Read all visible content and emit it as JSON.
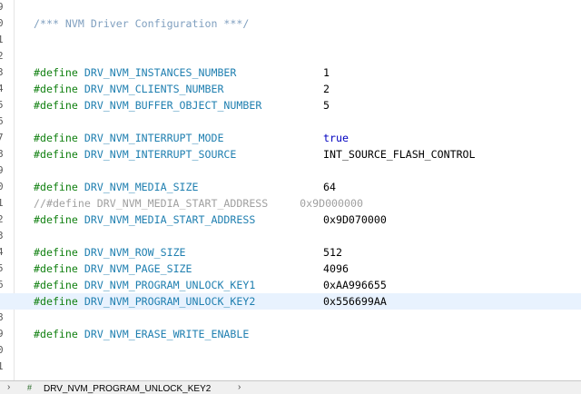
{
  "editor": {
    "line_numbers": [
      "9",
      "0",
      "1",
      "2",
      "3",
      "4",
      "5",
      "6",
      "7",
      "8",
      "9",
      "0",
      "1",
      "2",
      "3",
      "4",
      "5",
      "6",
      "7",
      "8",
      "9",
      "0",
      "1"
    ],
    "lines": [
      {
        "type": "blank"
      },
      {
        "type": "comment",
        "text": "/*** NVM Driver Configuration ***/"
      },
      {
        "type": "blank"
      },
      {
        "type": "blank"
      },
      {
        "type": "define",
        "keyword": "#define",
        "macro": "DRV_NVM_INSTANCES_NUMBER",
        "value": "1"
      },
      {
        "type": "define",
        "keyword": "#define",
        "macro": "DRV_NVM_CLIENTS_NUMBER",
        "value": "2"
      },
      {
        "type": "define",
        "keyword": "#define",
        "macro": "DRV_NVM_BUFFER_OBJECT_NUMBER",
        "value": "5"
      },
      {
        "type": "blank"
      },
      {
        "type": "define",
        "keyword": "#define",
        "macro": "DRV_NVM_INTERRUPT_MODE",
        "value": "true",
        "value_style": "kw"
      },
      {
        "type": "define",
        "keyword": "#define",
        "macro": "DRV_NVM_INTERRUPT_SOURCE",
        "value": "INT_SOURCE_FLASH_CONTROL"
      },
      {
        "type": "blank"
      },
      {
        "type": "define",
        "keyword": "#define",
        "macro": "DRV_NVM_MEDIA_SIZE",
        "value": "64"
      },
      {
        "type": "disabled",
        "text": "//#define DRV_NVM_MEDIA_START_ADDRESS     0x9D000000"
      },
      {
        "type": "define",
        "keyword": "#define",
        "macro": "DRV_NVM_MEDIA_START_ADDRESS",
        "value": "0x9D070000"
      },
      {
        "type": "blank"
      },
      {
        "type": "define",
        "keyword": "#define",
        "macro": "DRV_NVM_ROW_SIZE",
        "value": "512"
      },
      {
        "type": "define",
        "keyword": "#define",
        "macro": "DRV_NVM_PAGE_SIZE",
        "value": "4096"
      },
      {
        "type": "define",
        "keyword": "#define",
        "macro": "DRV_NVM_PROGRAM_UNLOCK_KEY1",
        "value": "0xAA996655"
      },
      {
        "type": "define",
        "keyword": "#define",
        "macro": "DRV_NVM_PROGRAM_UNLOCK_KEY2",
        "value": "0x556699AA",
        "current": true
      },
      {
        "type": "blank"
      },
      {
        "type": "define",
        "keyword": "#define",
        "macro": "DRV_NVM_ERASE_WRITE_ENABLE",
        "value": ""
      },
      {
        "type": "blank"
      },
      {
        "type": "blank"
      }
    ]
  },
  "statusbar": {
    "breadcrumb_separator": "›",
    "breadcrumb_icon": "#",
    "breadcrumb_label": "DRV_NVM_PROGRAM_UNLOCK_KEY2"
  }
}
